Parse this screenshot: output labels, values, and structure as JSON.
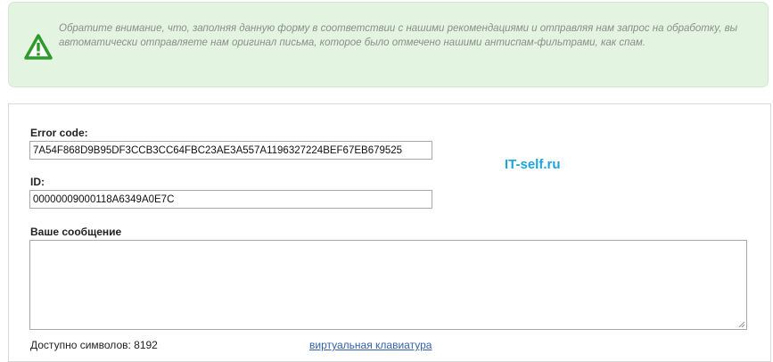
{
  "notice": {
    "icon": "warning-triangle-icon",
    "text": "Обратите внимание, что, заполняя данную форму в соответствии с нашими рекомендациями и отправляя нам запрос на обработку, вы автоматически отправляете нам оригинал письма, которое было отмечено нашими антиспам-фильтрами, как спам."
  },
  "form": {
    "error_code_label": "Error code:",
    "error_code_value": "7A54F868D9B95DF3CCB3CC64FBC23AE3A557A1196327224BEF67EB679525",
    "id_label": "ID:",
    "id_value": "00000009000118A6349A0E7C",
    "message_label": "Ваше сообщение",
    "message_value": "",
    "chars_left": "Доступно символов: 8192",
    "virtual_keyboard_link": "виртуальная клавиатура"
  },
  "watermark": "IT-self.ru",
  "colors": {
    "notice_bg": "#e3f4e0",
    "icon_green": "#2e9a2e",
    "watermark": "#1ea3de",
    "link": "#3360a8"
  }
}
